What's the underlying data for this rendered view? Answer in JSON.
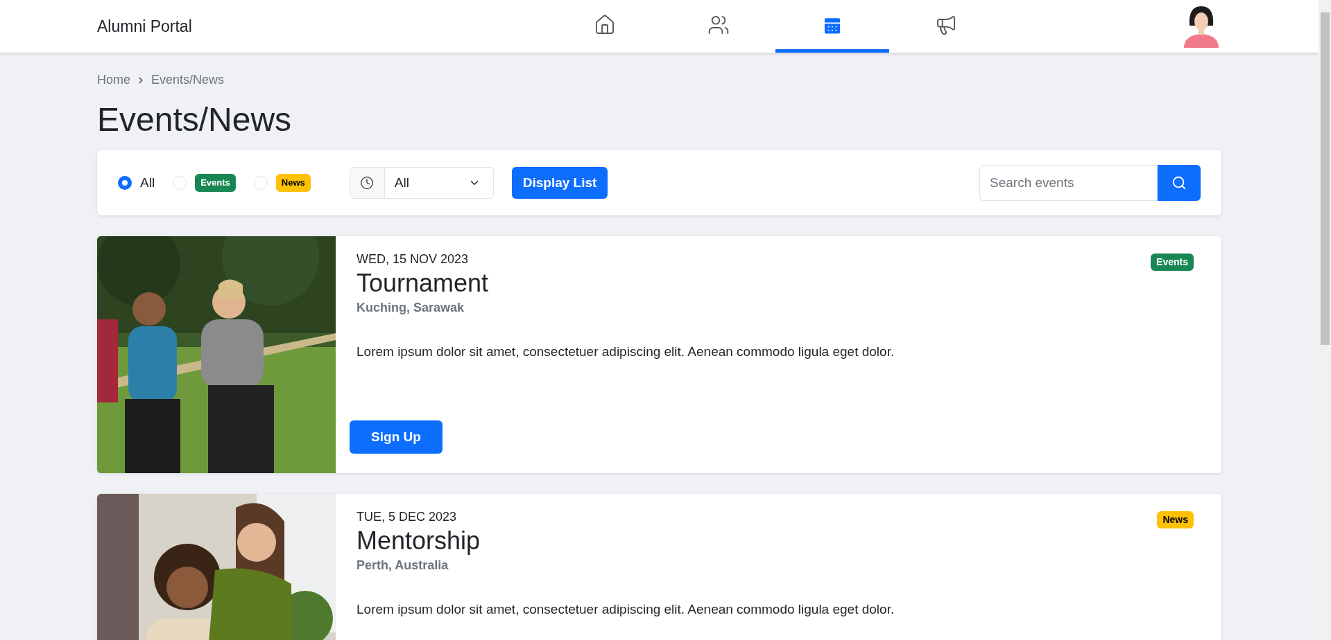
{
  "header": {
    "brand": "Alumni Portal",
    "nav": [
      {
        "kind": "home",
        "selected": false
      },
      {
        "kind": "people",
        "selected": false
      },
      {
        "kind": "calendar",
        "selected": true
      },
      {
        "kind": "megaphone",
        "selected": false
      }
    ]
  },
  "breadcrumb": [
    "Home",
    "Events/News"
  ],
  "page_title": "Events/News",
  "filters": {
    "types": [
      {
        "kind": "plain",
        "label": "All",
        "selected": true
      },
      {
        "kind": "events",
        "label": "Events",
        "selected": false
      },
      {
        "kind": "news",
        "label": "News",
        "selected": false
      }
    ],
    "time_select": {
      "value": "All"
    },
    "display_button": "Display List",
    "search": {
      "placeholder": "Search events"
    }
  },
  "items": [
    {
      "date": "WED, 15 NOV 2023",
      "title": "Tournament",
      "location": "Kuching, Sarawak",
      "tag": {
        "kind": "events",
        "label": "Events"
      },
      "description": "Lorem ipsum dolor sit amet, consectetuer adipiscing elit. Aenean commodo ligula eget dolor.",
      "button": "Sign Up"
    },
    {
      "date": "TUE, 5 DEC 2023",
      "title": "Mentorship",
      "location": "Perth, Australia",
      "tag": {
        "kind": "news",
        "label": "News"
      },
      "description": "Lorem ipsum dolor sit amet, consectetuer adipiscing elit. Aenean commodo ligula eget dolor."
    }
  ]
}
